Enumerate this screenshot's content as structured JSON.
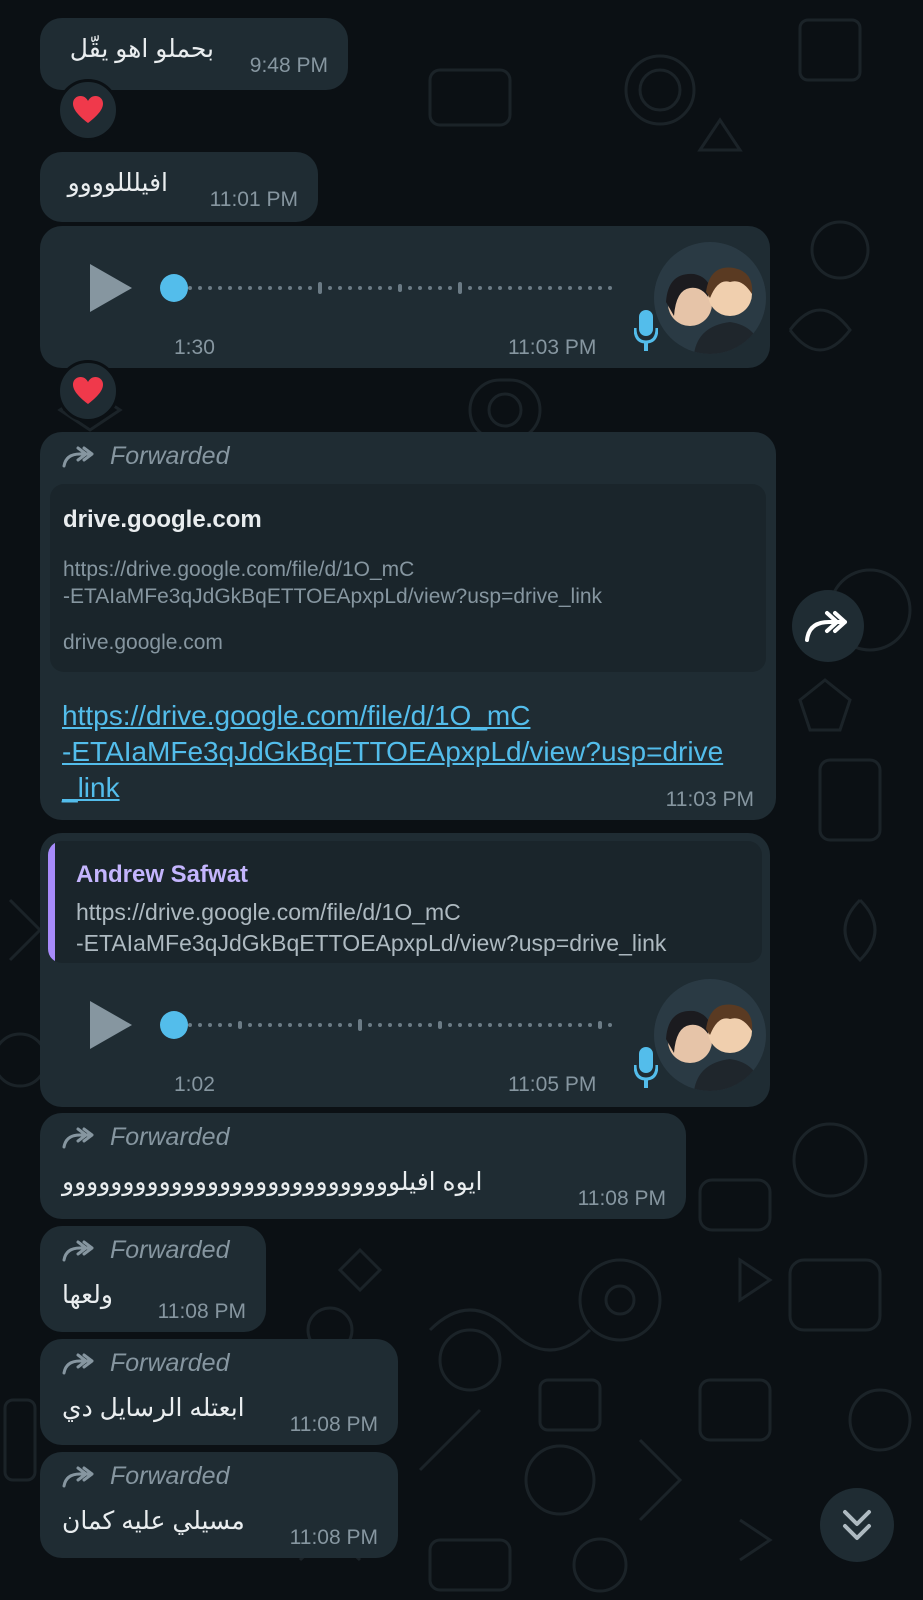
{
  "messages": [
    {
      "text": "بحملو اهو يقّل",
      "time": "9:48 PM",
      "reaction": "❤️"
    },
    {
      "text": "افيلللوووو",
      "time": "11:01 PM"
    },
    {
      "duration": "1:30",
      "time": "11:03 PM",
      "reaction": "❤️"
    },
    {
      "forwarded_label": "Forwarded",
      "preview_title": "drive.google.com",
      "preview_url_line1": "https://drive.google.com/file/d/1O_mC",
      "preview_url_line2": "-ETAIaMFe3qJdGkBqETTOEApxpLd/view?usp=drive_link",
      "preview_domain": "drive.google.com",
      "link_line1": "https://drive.google.com/file/d/1O_mC",
      "link_line2": "-ETAIaMFe3qJdGkBqETTOEApxpLd/view?usp=drive",
      "link_line3": "_link",
      "time": "11:03 PM"
    },
    {
      "quote_author": "Andrew Safwat",
      "quote_line1": "https://drive.google.com/file/d/1O_mC",
      "quote_line2": "-ETAIaMFe3qJdGkBqETTOEApxpLd/view?usp=drive_link",
      "duration": "1:02",
      "time": "11:05 PM"
    },
    {
      "forwarded_label": "Forwarded",
      "text": "ايوه افيلوووووووووووووووووووووووووووو",
      "time": "11:08 PM"
    },
    {
      "forwarded_label": "Forwarded",
      "text": "ولعها",
      "time": "11:08 PM"
    },
    {
      "forwarded_label": "Forwarded",
      "text": "ابعتله الرسايل دي",
      "time": "11:08 PM"
    },
    {
      "forwarded_label": "Forwarded",
      "text": "مسيلي عليه كمان",
      "time": "11:08 PM"
    }
  ],
  "icons": {
    "forward": "forward-arrow-icon",
    "play": "play-icon",
    "mic": "microphone-icon",
    "share": "share-forward-icon",
    "scroll": "double-chevron-down-icon",
    "reaction": "red-heart-emoji"
  },
  "colors": {
    "background": "#0b1014",
    "bubble": "#1f2c33",
    "accent_blue": "#53bdeb",
    "quote_author": "#c4b5fd",
    "link": "#53bdeb"
  }
}
